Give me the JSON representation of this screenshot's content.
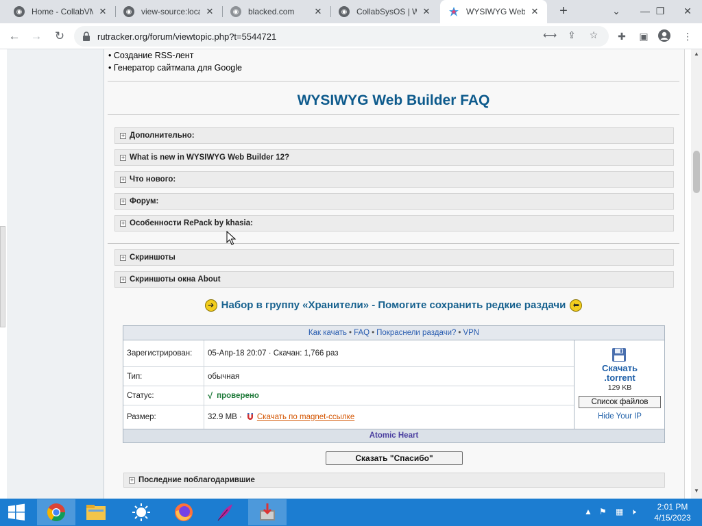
{
  "browser": {
    "tabs": [
      {
        "title": "Home - CollabVM",
        "close": "✕"
      },
      {
        "title": "view-source:localhost",
        "close": "✕"
      },
      {
        "title": "blacked.com",
        "close": "✕"
      },
      {
        "title": "CollabSysOS | Web",
        "close": "✕"
      },
      {
        "title": "WYSIWYG Web Builder",
        "close": "✕",
        "active": true
      }
    ],
    "new_tab": "+",
    "url": "rutracker.org/forum/viewtopic.php?t=5544721",
    "accent": "#1a73e8"
  },
  "post": {
    "bullets": [
      "• Создание RSS-лент",
      "• Генератор сайтмапа для Google"
    ],
    "faq_title": "WYSIWYG Web Builder FAQ",
    "spoilers": [
      "Дополнительно:",
      "What is new in WYSIWYG Web Builder 12?",
      "Что нового:",
      "Форум:",
      "Особенности RePack by khasia:"
    ],
    "spoilers2": [
      "Скриншоты",
      "Скриншоты окна About"
    ],
    "spoiler_plus": "+",
    "keepers_text": "Набор в группу «Хранители» - Помогите сохранить редкие раздачи",
    "title_color": "#0d5a8c"
  },
  "download_table": {
    "header_links": [
      "Как качать",
      "FAQ",
      "Покраснели раздачи?",
      "VPN"
    ],
    "header_sep": "•",
    "rows": [
      {
        "key": "Зарегистрирован:",
        "value": "05-Апр-18 20:07 · Скачан: 1,766 раз"
      },
      {
        "key": "Тип:",
        "value": "обычная"
      },
      {
        "key": "Статус:",
        "check": "√",
        "value": "проверено"
      },
      {
        "key": "Размер:",
        "value": "32.9 MB ·",
        "magnet": "Скачать по magnet-ссылке"
      }
    ],
    "download_label_1": "Скачать",
    "download_label_2": ".torrent",
    "torrent_size": "129 KB",
    "files_button": "Список файлов",
    "hide_ip": "Hide Your IP",
    "footer": "Atomic Heart",
    "status_color": "#1f7a3a"
  },
  "thanks_button": "Сказать \"Спасибо\"",
  "last_thanks": "Последние поблагодарившие",
  "taskbar": {
    "time": "2:01 PM",
    "date": "4/15/2023",
    "color": "#1c7dd1"
  }
}
